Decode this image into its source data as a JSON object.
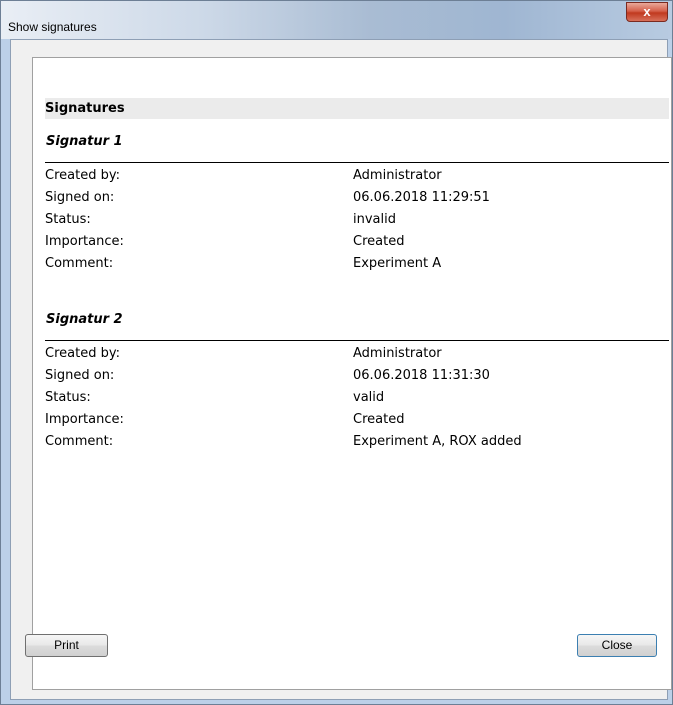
{
  "window": {
    "title": "Show signatures",
    "close_glyph": "x"
  },
  "report": {
    "heading": "Signatures",
    "signatures": [
      {
        "title": "Signatur 1",
        "fields": [
          {
            "label": "Created by:",
            "value": "Administrator"
          },
          {
            "label": "Signed on:",
            "value": "06.06.2018 11:29:51"
          },
          {
            "label": "Status:",
            "value": "invalid"
          },
          {
            "label": "Importance:",
            "value": "Created"
          },
          {
            "label": "Comment:",
            "value": "Experiment A"
          }
        ]
      },
      {
        "title": "Signatur 2",
        "fields": [
          {
            "label": "Created by:",
            "value": "Administrator"
          },
          {
            "label": "Signed on:",
            "value": "06.06.2018 11:31:30"
          },
          {
            "label": "Status:",
            "value": "valid"
          },
          {
            "label": "Importance:",
            "value": "Created"
          },
          {
            "label": "Comment:",
            "value": "Experiment A, ROX added"
          }
        ]
      }
    ]
  },
  "buttons": {
    "print_label": "Print",
    "close_label": "Close"
  },
  "colors": {
    "heading_bg": "#ebebeb",
    "titlebar_close": "#c0391f"
  }
}
